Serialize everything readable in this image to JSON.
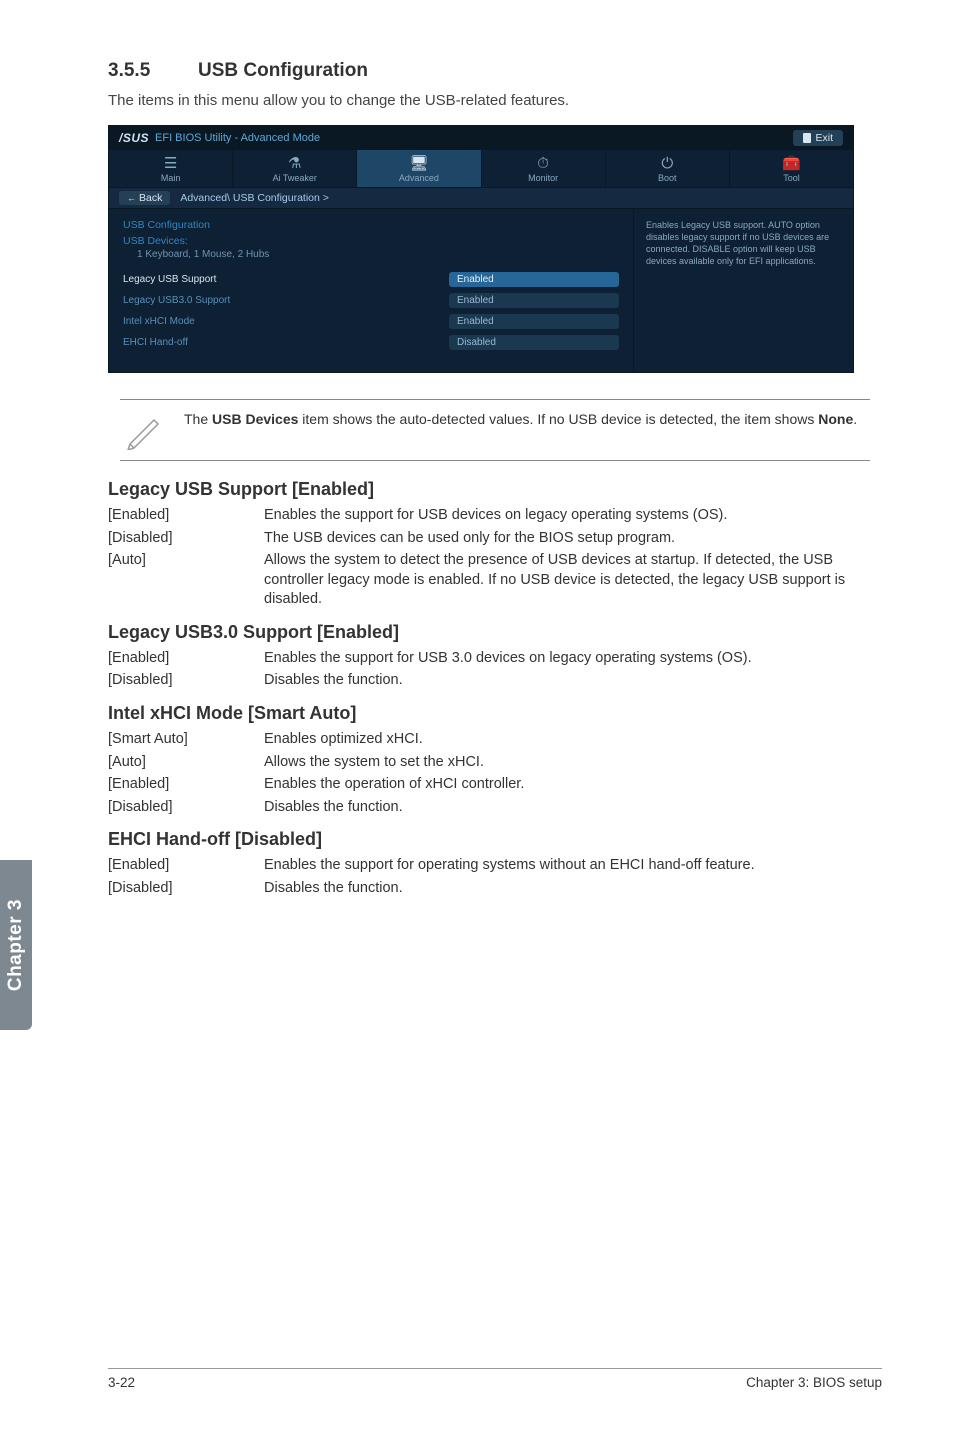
{
  "section": {
    "number": "3.5.5",
    "title": "USB Configuration",
    "intro": "The items in this menu allow you to change the USB-related features."
  },
  "bios": {
    "logo": "/SUS",
    "title": "EFI BIOS Utility - Advanced Mode",
    "exit_label": "Exit",
    "tabs": [
      {
        "icon": "☰",
        "label": "Main"
      },
      {
        "icon": "⚗",
        "label": "Ai Tweaker"
      },
      {
        "icon": "🖥",
        "label": "Advanced"
      },
      {
        "icon": "⏱",
        "label": "Monitor"
      },
      {
        "icon": "⏻",
        "label": "Boot"
      },
      {
        "icon": "🧰",
        "label": "Tool"
      }
    ],
    "back_label": "Back",
    "breadcrumb": "Advanced\\ USB Configuration  >",
    "config_heading": "USB Configuration",
    "devices_heading": "USB Devices:",
    "devices_detail": "1 Keyboard, 1 Mouse, 2 Hubs",
    "rows": [
      {
        "label": "Legacy USB Support",
        "value": "Enabled",
        "highlight": true
      },
      {
        "label": "Legacy USB3.0 Support",
        "value": "Enabled",
        "highlight": false
      },
      {
        "label": "Intel xHCI Mode",
        "value": "Enabled",
        "highlight": false
      },
      {
        "label": "EHCI Hand-off",
        "value": "Disabled",
        "highlight": false
      }
    ],
    "help_text": "Enables Legacy USB support. AUTO option disables legacy support if no USB devices are connected. DISABLE option will keep USB devices available only for EFI applications."
  },
  "note": {
    "text_prefix": "The ",
    "bold1": "USB Devices",
    "text_mid": " item shows the auto-detected values. If no USB device is detected, the item shows ",
    "bold2": "None",
    "text_end": "."
  },
  "settings": [
    {
      "heading": "Legacy USB Support [Enabled]",
      "options": [
        {
          "key": "[Enabled]",
          "desc": "Enables the support for USB devices on legacy operating systems (OS)."
        },
        {
          "key": "[Disabled]",
          "desc": "The USB devices can be used only for the BIOS setup program."
        },
        {
          "key": "[Auto]",
          "desc": "Allows the system to detect the presence of USB devices at startup. If detected, the USB controller legacy mode is enabled. If no USB device is detected, the legacy USB support is disabled."
        }
      ]
    },
    {
      "heading": "Legacy USB3.0 Support [Enabled]",
      "options": [
        {
          "key": "[Enabled]",
          "desc": "Enables the support for USB 3.0 devices on legacy operating systems (OS)."
        },
        {
          "key": "[Disabled]",
          "desc": "Disables the function."
        }
      ]
    },
    {
      "heading": "Intel xHCI Mode [Smart Auto]",
      "options": [
        {
          "key": "[Smart Auto]",
          "desc": "Enables optimized xHCI."
        },
        {
          "key": "[Auto]",
          "desc": "Allows the system to set the xHCI."
        },
        {
          "key": "[Enabled]",
          "desc": "Enables the operation of xHCI controller."
        },
        {
          "key": "[Disabled]",
          "desc": "Disables the function."
        }
      ]
    },
    {
      "heading": "EHCI Hand-off [Disabled]",
      "options": [
        {
          "key": "[Enabled]",
          "desc": "Enables the support for operating systems without an EHCI hand-off feature."
        },
        {
          "key": "[Disabled]",
          "desc": "Disables the function."
        }
      ]
    }
  ],
  "chapter_tab": "Chapter 3",
  "footer": {
    "left": "3-22",
    "right": "Chapter 3: BIOS setup"
  }
}
